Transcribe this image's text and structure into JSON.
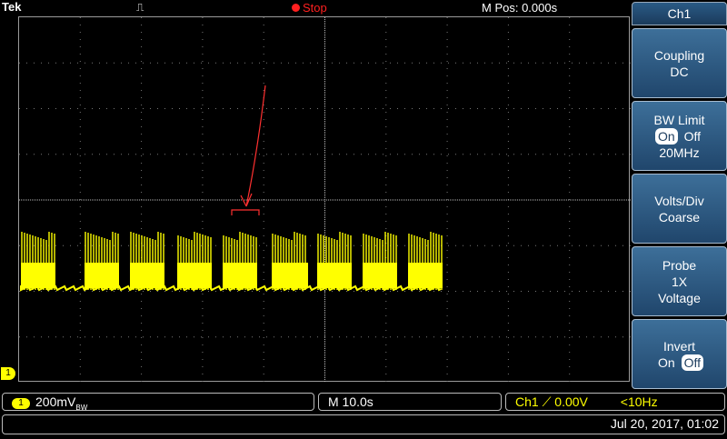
{
  "header": {
    "brand": "Tek",
    "trigger_icon": "trigger-edge-icon",
    "run_state": "Stop",
    "horizontal_position": "M Pos: 0.000s"
  },
  "menu": {
    "title": "Ch1",
    "coupling": {
      "label": "Coupling",
      "value": "DC"
    },
    "bw_limit": {
      "label": "BW Limit",
      "on": "On",
      "off": "Off",
      "value": "20MHz",
      "selected": "On"
    },
    "volts_div": {
      "label": "Volts/Div",
      "value": "Coarse"
    },
    "probe": {
      "label": "Probe",
      "value1": "1X",
      "value2": "Voltage"
    },
    "invert": {
      "label": "Invert",
      "on": "On",
      "off": "Off",
      "selected": "Off"
    }
  },
  "channel_marker": "1",
  "status": {
    "ch_badge": "1",
    "volts": "200mV",
    "bw_subscript": "BW",
    "timebase": "M 10.0s",
    "trigger_source": "Ch1",
    "trigger_slope_icon": "rising-edge-icon",
    "trigger_level": "0.00V",
    "trigger_freq": "<10Hz",
    "datetime": "Jul 20, 2017, 01:02"
  },
  "colors": {
    "trace": "#ffff00",
    "annotation": "#ff2020",
    "menu": "#2c5a86"
  }
}
